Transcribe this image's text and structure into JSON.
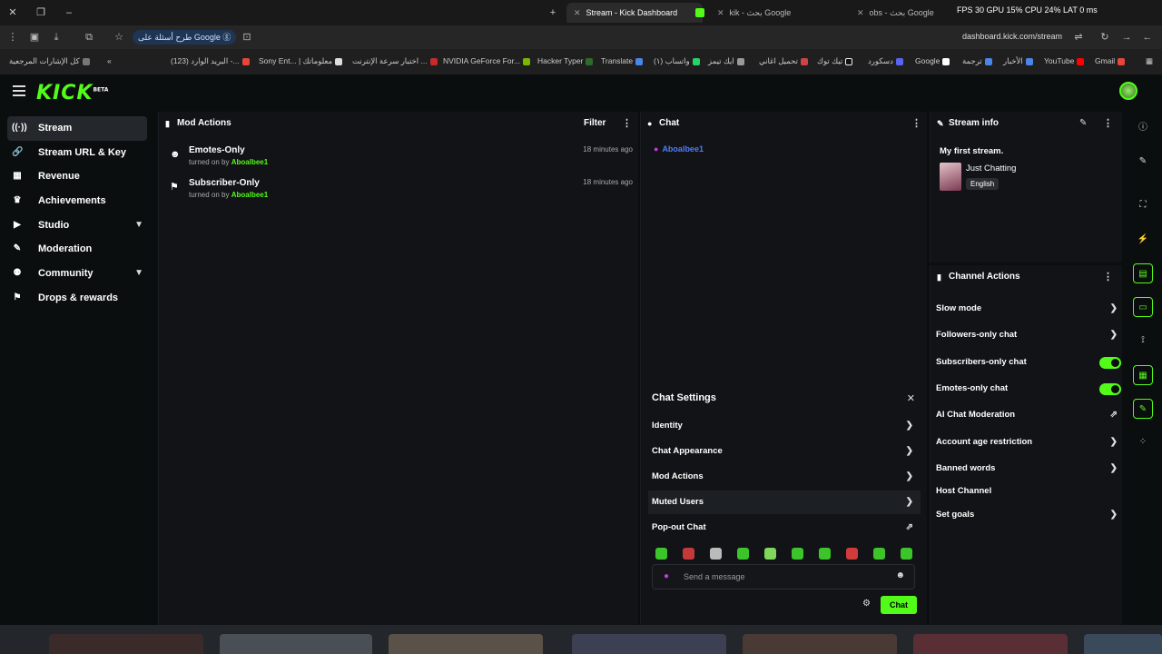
{
  "browser": {
    "tabs": [
      {
        "label": "Stream - Kick Dashboard",
        "active": true
      },
      {
        "label": "kik - بحث Google",
        "active": false
      },
      {
        "label": "obs - بحث Google",
        "active": false
      }
    ],
    "stats": "FPS 30   GPU 15%   CPU 24%   LAT 0 ms",
    "search_chip": "طرح أسئلة على Google",
    "url": "dashboard.kick.com/stream",
    "bookmarks": [
      "كل الإشارات المرجعية",
      "(123) البريد الوارد -...",
      "Sony Ent... | معلوماتك",
      "اختبار سرعة الإنترنت ...",
      "NVIDIA GeForce For...",
      "Hacker Typer",
      "Translate",
      "(١) واتساب",
      "ايك تيمز",
      "تحميل اغاني",
      "تيك توك",
      "دسكورد",
      "Google",
      "ترجمة",
      "الأخبار",
      "YouTube",
      "Gmail"
    ]
  },
  "brand": {
    "logo": "KICK",
    "badge": "BETA"
  },
  "sidebar": {
    "items": [
      {
        "label": "Stream",
        "icon": "broadcast-icon"
      },
      {
        "label": "Stream URL & Key",
        "icon": "link-icon"
      },
      {
        "label": "Revenue",
        "icon": "revenue-icon"
      },
      {
        "label": "Achievements",
        "icon": "trophy-icon"
      },
      {
        "label": "Studio",
        "icon": "studio-icon"
      },
      {
        "label": "Moderation",
        "icon": "wrench-icon"
      },
      {
        "label": "Community",
        "icon": "people-icon"
      },
      {
        "label": "Drops & rewards",
        "icon": "gift-icon"
      }
    ]
  },
  "mod_actions": {
    "title": "Mod Actions",
    "filter_label": "Filter",
    "rows": [
      {
        "title": "Emotes-Only",
        "by_prefix": "turned on by",
        "user": "Aboalbee1",
        "time": "18 minutes ago"
      },
      {
        "title": "Subscriber-Only",
        "by_prefix": "turned on by",
        "user": "Aboalbee1",
        "time": "18 minutes ago"
      }
    ]
  },
  "chat": {
    "title": "Chat",
    "user": "Aboalbee1",
    "settings": {
      "title": "Chat Settings",
      "rows": [
        "Identity",
        "Chat Appearance",
        "Mod Actions",
        "Muted Users",
        "Pop-out Chat"
      ]
    },
    "input_placeholder": "Send a message",
    "send_label": "Chat"
  },
  "stream_info": {
    "title": "Stream info",
    "stream_title": "My first stream.",
    "category": "Just Chatting",
    "language": "English"
  },
  "channel_actions": {
    "title": "Channel Actions",
    "rows": [
      {
        "label": "Slow mode",
        "control": "arrow"
      },
      {
        "label": "Followers-only chat",
        "control": "arrow"
      },
      {
        "label": "Subscribers-only chat",
        "control": "toggle-on"
      },
      {
        "label": "Emotes-only chat",
        "control": "toggle-on"
      },
      {
        "label": "AI Chat Moderation",
        "control": "external"
      },
      {
        "label": "Account age restriction",
        "control": "arrow"
      },
      {
        "label": "Banned words",
        "control": "arrow"
      },
      {
        "label": "Host Channel",
        "control": "none"
      },
      {
        "label": "Set goals",
        "control": "arrow"
      }
    ]
  },
  "colors": {
    "accent": "#53fc18",
    "background": "#0b0e0f",
    "panel": "#111316"
  }
}
